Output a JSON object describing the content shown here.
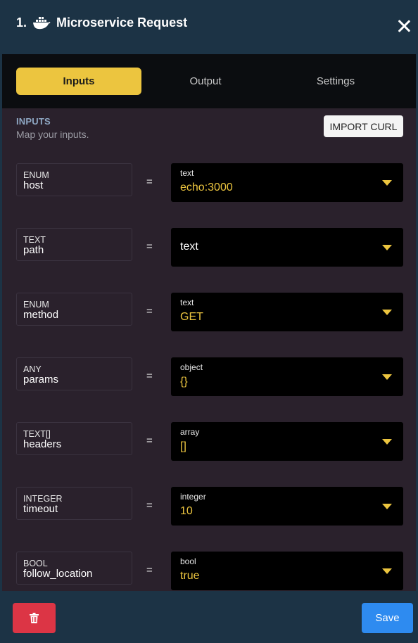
{
  "header": {
    "step_number": "1.",
    "title": "Microservice Request",
    "icon": "docker-whale-icon"
  },
  "tabs": [
    {
      "label": "Inputs",
      "active": true
    },
    {
      "label": "Output",
      "active": false
    },
    {
      "label": "Settings",
      "active": false
    }
  ],
  "section": {
    "title": "INPUTS",
    "subtitle": "Map your inputs.",
    "import_button": "IMPORT CURL"
  },
  "inputs": [
    {
      "type": "ENUM",
      "name": "host",
      "value_type": "text",
      "value": "echo:3000"
    },
    {
      "type": "TEXT",
      "name": "path",
      "value_type": "",
      "value": "text"
    },
    {
      "type": "ENUM",
      "name": "method",
      "value_type": "text",
      "value": "GET"
    },
    {
      "type": "ANY",
      "name": "params",
      "value_type": "object",
      "value": "{}"
    },
    {
      "type": "TEXT[]",
      "name": "headers",
      "value_type": "array",
      "value": "[]"
    },
    {
      "type": "INTEGER",
      "name": "timeout",
      "value_type": "integer",
      "value": "10"
    },
    {
      "type": "BOOL",
      "name": "follow_location",
      "value_type": "bool",
      "value": "true"
    }
  ],
  "equals_sign": "=",
  "footer": {
    "save_label": "Save",
    "delete_icon": "trash-icon"
  },
  "colors": {
    "accent": "#ecc53f",
    "header_bg": "#1c3345",
    "panel_bg": "#2a212c",
    "save": "#2e8bf0",
    "delete": "#dc3545"
  }
}
